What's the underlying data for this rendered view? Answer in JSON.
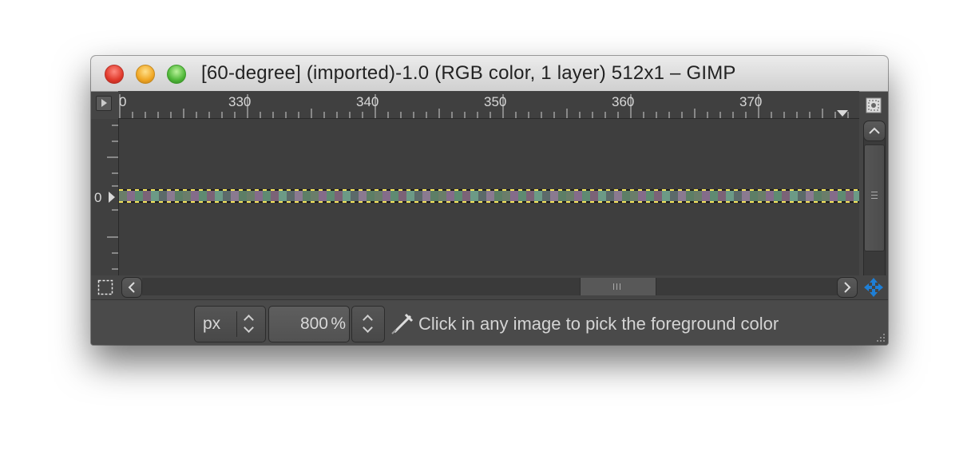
{
  "window": {
    "title": "[60-degree] (imported)-1.0 (RGB color, 1 layer) 512x1 – GIMP"
  },
  "rulers": {
    "horizontal_labels": [
      "0",
      "330",
      "340",
      "350",
      "360",
      "370"
    ],
    "vertical_labels": [
      "0"
    ]
  },
  "statusbar": {
    "unit": "px",
    "zoom_value": "800",
    "zoom_unit": "%",
    "message": "Click in any image to pick the foreground color"
  },
  "icons": {
    "quick_mask": "quick-mask-icon",
    "navigate": "navigate-icon",
    "zoom_fit": "zoom-fit-icon",
    "color_picker": "color-picker-icon"
  },
  "colors": {
    "window_bg": "#454545",
    "canvas_bg": "#3e3e3e",
    "selection_dash": "#f2e25a",
    "navigate_accent": "#1e7fd6"
  }
}
